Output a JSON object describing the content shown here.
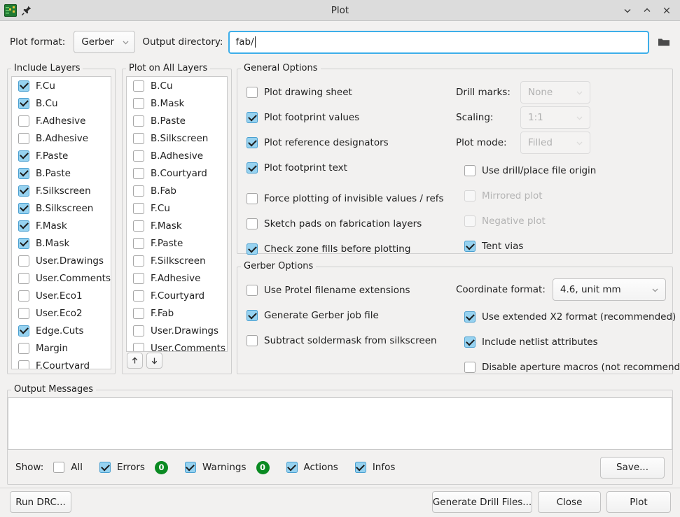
{
  "window": {
    "title": "Plot",
    "icon": "kicad-pcb-icon",
    "pin_icon": "pin-icon",
    "minimize_icon": "chevron-down-icon",
    "maximize_icon": "chevron-up-icon",
    "close_icon": "close-icon"
  },
  "top": {
    "plot_format_label": "Plot format:",
    "plot_format_value": "Gerber",
    "output_directory_label": "Output directory:",
    "output_directory_value": "fab/",
    "browse_icon": "folder-icon"
  },
  "include_layers": {
    "title": "Include Layers",
    "items": [
      {
        "label": "F.Cu",
        "checked": true
      },
      {
        "label": "B.Cu",
        "checked": true
      },
      {
        "label": "F.Adhesive",
        "checked": false
      },
      {
        "label": "B.Adhesive",
        "checked": false
      },
      {
        "label": "F.Paste",
        "checked": true
      },
      {
        "label": "B.Paste",
        "checked": true
      },
      {
        "label": "F.Silkscreen",
        "checked": true
      },
      {
        "label": "B.Silkscreen",
        "checked": true
      },
      {
        "label": "F.Mask",
        "checked": true
      },
      {
        "label": "B.Mask",
        "checked": true
      },
      {
        "label": "User.Drawings",
        "checked": false
      },
      {
        "label": "User.Comments",
        "checked": false
      },
      {
        "label": "User.Eco1",
        "checked": false
      },
      {
        "label": "User.Eco2",
        "checked": false
      },
      {
        "label": "Edge.Cuts",
        "checked": true
      },
      {
        "label": "Margin",
        "checked": false
      },
      {
        "label": "F.Courtyard",
        "checked": false
      }
    ]
  },
  "plot_on_all_layers": {
    "title": "Plot on All Layers",
    "items": [
      {
        "label": "B.Cu",
        "checked": false
      },
      {
        "label": "B.Mask",
        "checked": false
      },
      {
        "label": "B.Paste",
        "checked": false
      },
      {
        "label": "B.Silkscreen",
        "checked": false
      },
      {
        "label": "B.Adhesive",
        "checked": false
      },
      {
        "label": "B.Courtyard",
        "checked": false
      },
      {
        "label": "B.Fab",
        "checked": false
      },
      {
        "label": "F.Cu",
        "checked": false
      },
      {
        "label": "F.Mask",
        "checked": false
      },
      {
        "label": "F.Paste",
        "checked": false
      },
      {
        "label": "F.Silkscreen",
        "checked": false
      },
      {
        "label": "F.Adhesive",
        "checked": false
      },
      {
        "label": "F.Courtyard",
        "checked": false
      },
      {
        "label": "F.Fab",
        "checked": false
      },
      {
        "label": "User.Drawings",
        "checked": false
      },
      {
        "label": "User.Comments",
        "checked": false
      }
    ],
    "move_up_icon": "arrow-up-icon",
    "move_down_icon": "arrow-down-icon"
  },
  "general_options": {
    "title": "General Options",
    "checkboxes": [
      {
        "label": "Plot drawing sheet",
        "checked": false,
        "enabled": true
      },
      {
        "label": "Plot footprint values",
        "checked": true,
        "enabled": true
      },
      {
        "label": "Plot reference designators",
        "checked": true,
        "enabled": true
      },
      {
        "label": "Plot footprint text",
        "checked": true,
        "enabled": true
      },
      {
        "label": "Force plotting of invisible values / refs",
        "checked": false,
        "enabled": true
      },
      {
        "label": "Sketch pads on fabrication layers",
        "checked": false,
        "enabled": true
      },
      {
        "label": "Check zone fills before plotting",
        "checked": true,
        "enabled": true
      }
    ],
    "drill_marks_label": "Drill marks:",
    "drill_marks_value": "None",
    "scaling_label": "Scaling:",
    "scaling_value": "1:1",
    "plot_mode_label": "Plot mode:",
    "plot_mode_value": "Filled",
    "right_checkboxes": [
      {
        "label": "Use drill/place file origin",
        "checked": false,
        "enabled": true
      },
      {
        "label": "Mirrored plot",
        "checked": false,
        "enabled": false
      },
      {
        "label": "Negative plot",
        "checked": false,
        "enabled": false
      },
      {
        "label": "Tent vias",
        "checked": true,
        "enabled": true
      }
    ]
  },
  "gerber_options": {
    "title": "Gerber Options",
    "left_checkboxes": [
      {
        "label": "Use Protel filename extensions",
        "checked": false,
        "enabled": true
      },
      {
        "label": "Generate Gerber job file",
        "checked": true,
        "enabled": true
      },
      {
        "label": "Subtract soldermask from silkscreen",
        "checked": false,
        "enabled": true
      }
    ],
    "coordinate_format_label": "Coordinate format:",
    "coordinate_format_value": "4.6, unit mm",
    "right_checkboxes": [
      {
        "label": "Use extended X2 format (recommended)",
        "checked": true,
        "enabled": true
      },
      {
        "label": "Include netlist attributes",
        "checked": true,
        "enabled": true
      },
      {
        "label": "Disable aperture macros (not recommended)",
        "checked": false,
        "enabled": true
      }
    ]
  },
  "output_messages": {
    "title": "Output Messages",
    "body": "",
    "show_label": "Show:",
    "filters": [
      {
        "label": "All",
        "checked": false,
        "count": null
      },
      {
        "label": "Errors",
        "checked": true,
        "count": "0"
      },
      {
        "label": "Warnings",
        "checked": true,
        "count": "0"
      },
      {
        "label": "Actions",
        "checked": true,
        "count": null
      },
      {
        "label": "Infos",
        "checked": true,
        "count": null
      }
    ],
    "save_label": "Save..."
  },
  "footer": {
    "run_drc_label": "Run DRC...",
    "generate_drill_files_label": "Generate Drill Files...",
    "close_label": "Close",
    "plot_label": "Plot"
  },
  "colors": {
    "accent": "#3daee9",
    "checkbox_on": "#96d2f0",
    "badge_green": "#0a8a22",
    "window_bg": "#f2f1f0",
    "titlebar_bg": "#dcdcdc"
  }
}
